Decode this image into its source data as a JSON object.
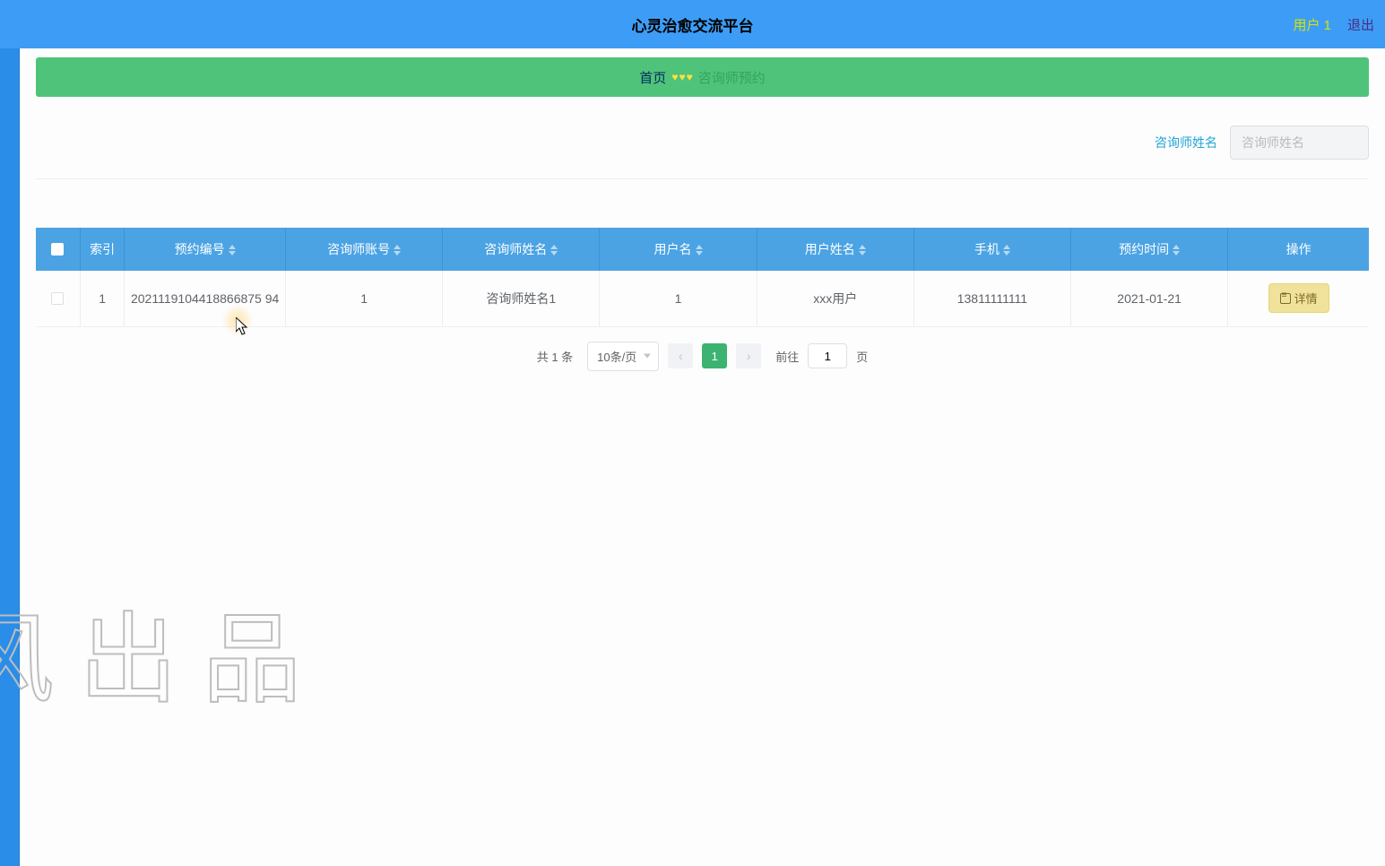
{
  "header": {
    "title": "心灵治愈交流平台",
    "user_label": "用户 1",
    "logout_label": "退出"
  },
  "breadcrumb": {
    "home": "首页",
    "current": "咨询师预约"
  },
  "filter": {
    "label": "咨询师姓名",
    "placeholder": "咨询师姓名"
  },
  "table": {
    "headers": {
      "index": "索引",
      "order_no": "预约编号",
      "consultant_account": "咨询师账号",
      "consultant_name": "咨询师姓名",
      "username": "用户名",
      "user_display": "用户姓名",
      "phone": "手机",
      "time": "预约时间",
      "operation": "操作"
    },
    "rows": [
      {
        "index": "1",
        "order_no": "2021119104418866875 94",
        "consultant_account": "1",
        "consultant_name": "咨询师姓名1",
        "username": "1",
        "user_display": "xxx用户",
        "phone": "13811111111",
        "time": "2021-01-21",
        "detail_label": "详情"
      }
    ]
  },
  "pagination": {
    "total_text": "共 1 条",
    "page_size_label": "10条/页",
    "current_page": "1",
    "goto_pre": "前往",
    "goto_value": "1",
    "goto_post": "页"
  },
  "watermark": "风出品"
}
